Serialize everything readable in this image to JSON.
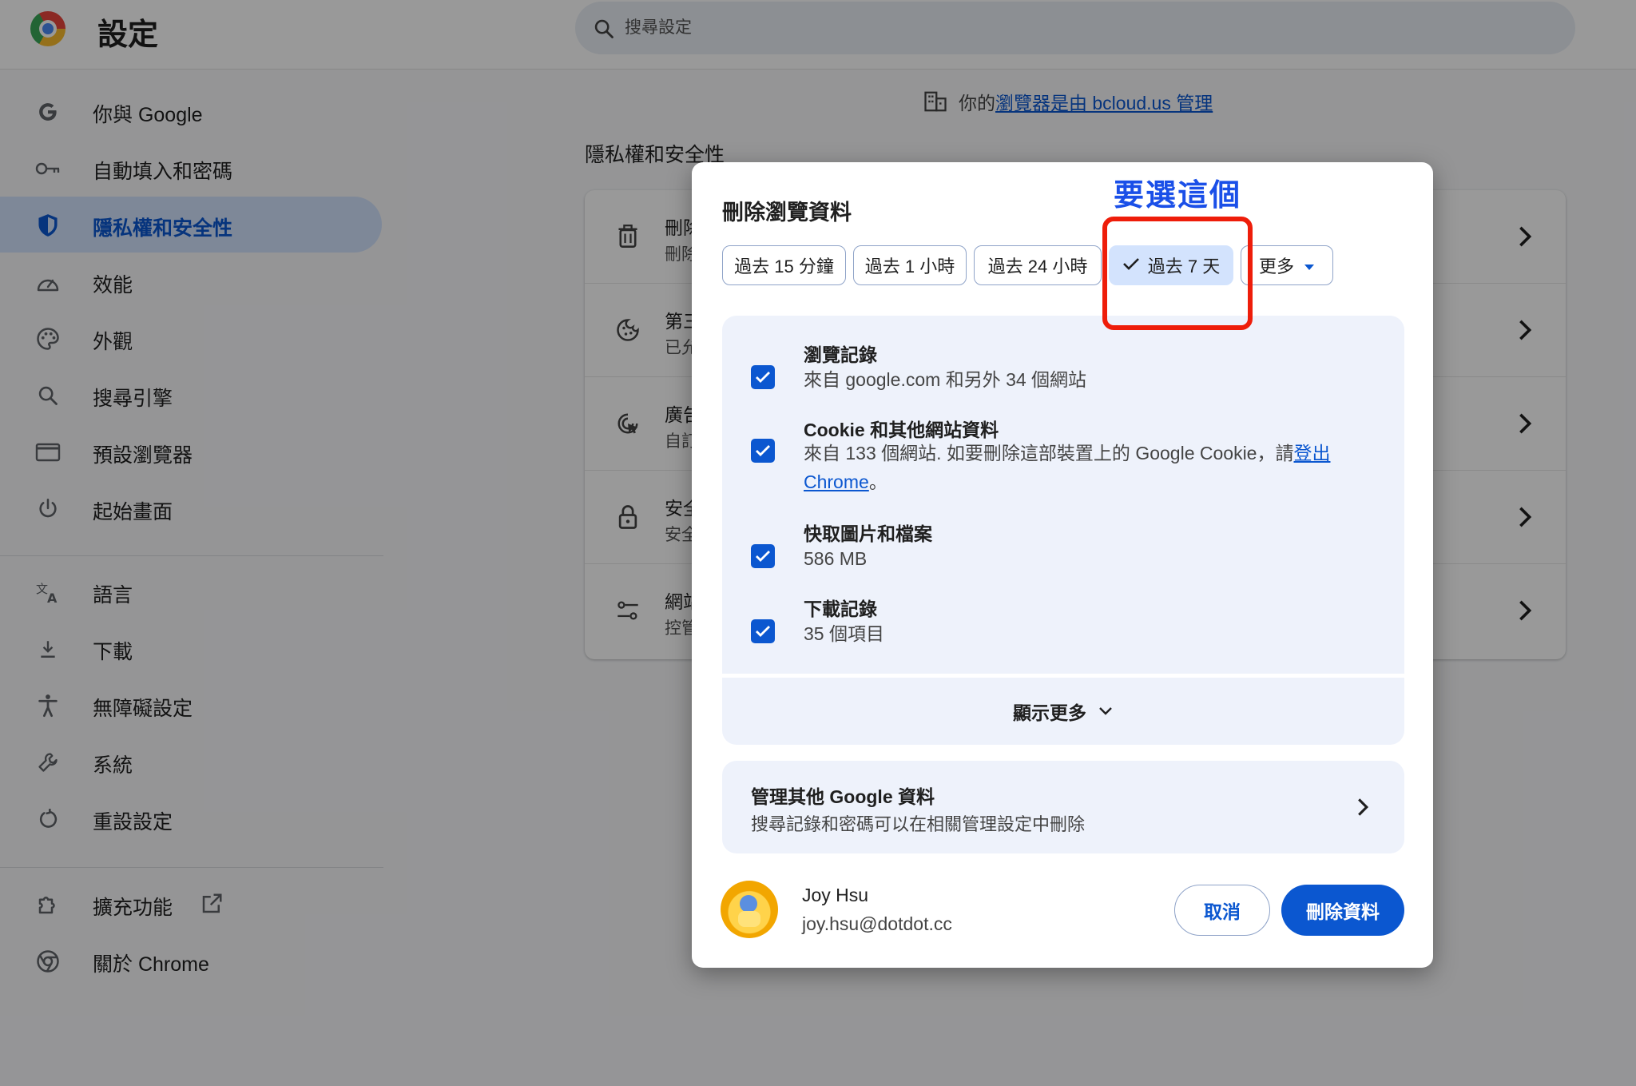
{
  "app": {
    "title": "設定"
  },
  "search": {
    "placeholder": "搜尋設定"
  },
  "sidebar": {
    "items": [
      {
        "label": "你與 Google",
        "icon": "google-g-icon"
      },
      {
        "label": "自動填入和密碼",
        "icon": "key-icon"
      },
      {
        "label": "隱私權和安全性",
        "icon": "shield-icon",
        "active": true
      },
      {
        "label": "效能",
        "icon": "speedometer-icon"
      },
      {
        "label": "外觀",
        "icon": "palette-icon"
      },
      {
        "label": "搜尋引擎",
        "icon": "search-icon"
      },
      {
        "label": "預設瀏覽器",
        "icon": "browser-window-icon"
      },
      {
        "label": "起始畫面",
        "icon": "power-icon"
      },
      {
        "label": "語言",
        "icon": "translate-icon"
      },
      {
        "label": "下載",
        "icon": "download-icon"
      },
      {
        "label": "無障礙設定",
        "icon": "accessibility-icon"
      },
      {
        "label": "系統",
        "icon": "wrench-icon"
      },
      {
        "label": "重設設定",
        "icon": "reset-icon"
      },
      {
        "label": "擴充功能",
        "icon": "puzzle-icon"
      },
      {
        "label": "關於 Chrome",
        "icon": "chrome-icon"
      }
    ]
  },
  "main": {
    "managed_prefix": "你的",
    "managed_link": "瀏覽器是由 bcloud.us 管理",
    "section_title": "隱私權和安全性",
    "rows": [
      {
        "t1": "刪除",
        "t2": "刪除",
        "icon": "trash-icon"
      },
      {
        "t1": "第三",
        "t2": "已允",
        "icon": "cookie-icon"
      },
      {
        "t1": "廣告",
        "t2": "自訂",
        "icon": "ad-privacy-icon"
      },
      {
        "t1": "安全",
        "t2": "安全",
        "icon": "lock-icon"
      },
      {
        "t1": "網站",
        "t2": "控管",
        "icon": "tune-icon"
      }
    ]
  },
  "dialog": {
    "title": "刪除瀏覽資料",
    "chips": [
      {
        "label": "過去 15 分鐘",
        "selected": false
      },
      {
        "label": "過去 1 小時",
        "selected": false
      },
      {
        "label": "過去 24 小時",
        "selected": false
      },
      {
        "label": "過去 7 天",
        "selected": true
      },
      {
        "label": "更多",
        "selected": false
      }
    ],
    "options": [
      {
        "title": "瀏覽記錄",
        "desc": "來自 google.com 和另外 34 個網站",
        "checked": true
      },
      {
        "title": "Cookie 和其他網站資料",
        "desc_prefix": "來自 133 個網站. 如要刪除這部裝置上的 Google Cookie，請",
        "desc_link": "登出 Chrome",
        "desc_suffix": "。",
        "checked": true
      },
      {
        "title": "快取圖片和檔案",
        "desc": "586 MB",
        "checked": true
      },
      {
        "title": "下載記錄",
        "desc": "35 個項目",
        "checked": true
      }
    ],
    "show_more": "顯示更多",
    "manage": {
      "title": "管理其他 Google 資料",
      "desc": "搜尋記錄和密碼可以在相關管理設定中刪除"
    },
    "user": {
      "name": "Joy Hsu",
      "email": "joy.hsu@dotdot.cc"
    },
    "cancel_label": "取消",
    "delete_label": "刪除資料"
  },
  "annotation": {
    "text": "要選這個",
    "color": "#1a4fe8",
    "box_color": "#ee1d0a"
  },
  "colors": {
    "accent": "#0b57d0",
    "active_nav_bg": "#d3e3fd",
    "panel_bg": "#eef2fb"
  }
}
